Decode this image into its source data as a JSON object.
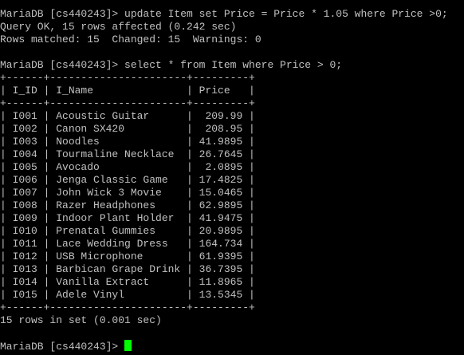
{
  "terminal": {
    "lines": [
      "MariaDB [cs440243]> update Item set Price = Price * 1.05 where Price >0;",
      "Query OK, 15 rows affected (0.242 sec)",
      "Rows matched: 15  Changed: 15  Warnings: 0",
      "",
      "MariaDB [cs440243]> select * from Item where Price > 0;",
      "+------+----------------------+---------+",
      "| I_ID | I_Name               | Price   |",
      "+------+----------------------+---------+",
      "| I001 | Acoustic Guitar      |  209.99 |",
      "| I002 | Canon SX420          |  208.95 |",
      "| I003 | Noodles              | 41.9895 |",
      "| I004 | Tourmaline Necklace  | 26.7645 |",
      "| I005 | Avocado              |  2.0895 |",
      "| I006 | Jenga Classic Game   | 17.4825 |",
      "| I007 | John Wick 3 Movie    | 15.0465 |",
      "| I008 | Razer Headphones     | 62.9895 |",
      "| I009 | Indoor Plant Holder  | 41.9475 |",
      "| I010 | Prenatal Gummies     | 20.9895 |",
      "| I011 | Lace Wedding Dress   | 164.734 |",
      "| I012 | USB Microphone       | 61.9395 |",
      "| I013 | Barbican Grape Drink | 36.7395 |",
      "| I014 | Vanilla Extract      | 11.8965 |",
      "| I015 | Adele Vinyl          | 13.5345 |",
      "+------+----------------------+---------+",
      "15 rows in set (0.001 sec)",
      "",
      "MariaDB [cs440243]> "
    ],
    "colors": {
      "background": "#000000",
      "text": "#c0c0c0",
      "cursor": "#00ff00"
    }
  }
}
